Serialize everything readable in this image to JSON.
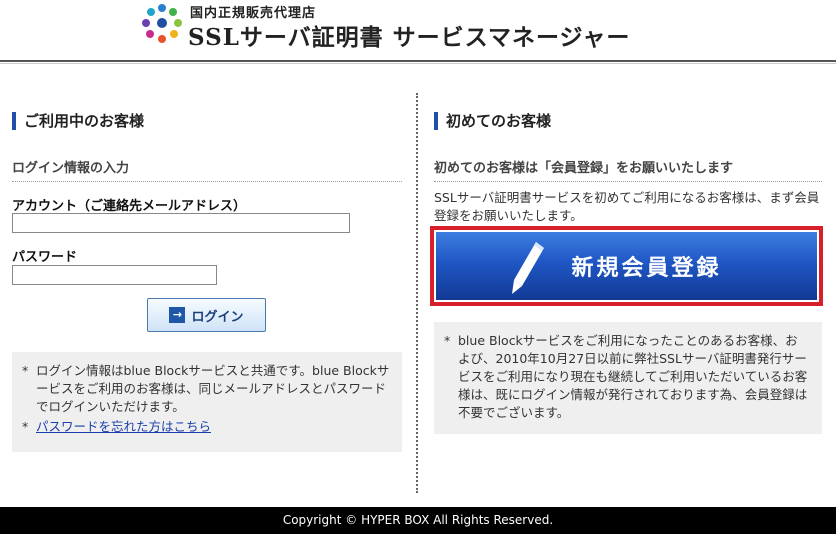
{
  "header": {
    "tagline": "国内正規販売代理店",
    "title": "SSLサーバ証明書 サービスマネージャー"
  },
  "login": {
    "section_title": "ご利用中のお客様",
    "subtitle": "ログイン情報の入力",
    "account_label": "アカウント（ご連絡先メールアドレス）",
    "account_value": "",
    "password_label": "パスワード",
    "password_value": "",
    "login_button": "ログイン",
    "login_icon": "→",
    "note1": "ログイン情報はblue Blockサービスと共通です。blue Blockサービスをご利用のお客様は、同じメールアドレスとパスワードでログインいただけます。",
    "forgot_link": "パスワードを忘れた方はこちら",
    "asterisk": "*"
  },
  "register": {
    "section_title": "初めてのお客様",
    "subtitle": "初めてのお客様は「会員登録」をお願いいたします",
    "intro": "SSLサーバ証明書サービスを初めてご利用になるお客様は、まず会員登録をお願いいたします。",
    "button_label": "新規会員登録",
    "note": "blue Blockサービスをご利用になったことのあるお客様、および、2010年10月27日以前に弊社SSLサーバ証明書発行サービスをご利用になり現在も継続してご利用いただいているお客様は、既にログイン情報が発行されております為、会員登録は不要でございます。",
    "asterisk": "*"
  },
  "footer": {
    "copyright": "Copyright © HYPER BOX All Rights Reserved."
  },
  "colors": {
    "accent_blue": "#1f56c4",
    "highlight_red": "#d8202a",
    "section_bar": "#1f4fa8"
  }
}
